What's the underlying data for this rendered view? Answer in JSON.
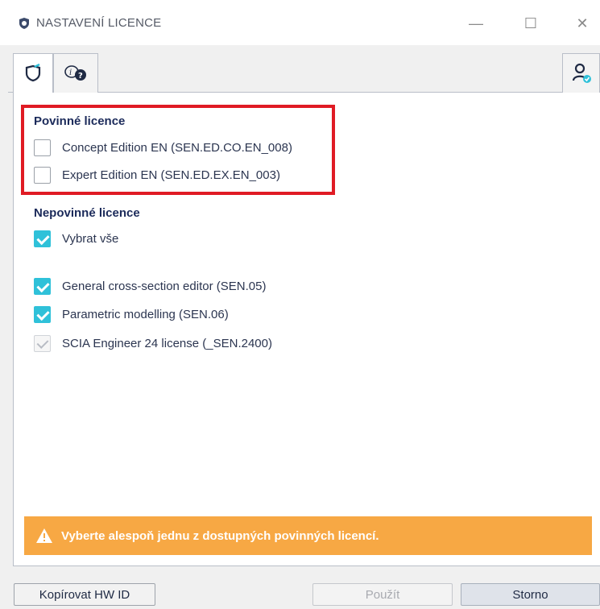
{
  "window": {
    "title": "NASTAVENÍ LICENCE",
    "minimize_glyph": "—",
    "maximize_glyph": "☐",
    "close_glyph": "✕"
  },
  "tabs": [
    {
      "icon": "shield-check-icon",
      "active": true
    },
    {
      "icon": "license-info-icon",
      "active": false
    },
    {
      "icon": "user-check-icon",
      "active": false
    }
  ],
  "mandatory": {
    "title": "Povinné licence",
    "items": [
      {
        "label": "Concept Edition EN (SEN.ED.CO.EN_008)",
        "checked": false
      },
      {
        "label": "Expert Edition EN (SEN.ED.EX.EN_003)",
        "checked": false
      }
    ]
  },
  "optional": {
    "title": "Nepovinné licence",
    "select_all": {
      "label": "Vybrat vše",
      "checked": true
    },
    "items": [
      {
        "label": "General cross-section editor (SEN.05)",
        "checked": true
      },
      {
        "label": "Parametric modelling (SEN.06)",
        "checked": true
      },
      {
        "label": "SCIA Engineer 24 license (_SEN.2400)",
        "checked": true,
        "disabled": true
      }
    ]
  },
  "warning": {
    "text": "Vyberte alespoň jednu z dostupných povinných licencí.",
    "color": "#f7a844"
  },
  "buttons": {
    "copy_hw": "Kopírovat HW ID",
    "apply": "Použít",
    "cancel": "Storno"
  },
  "colors": {
    "accent": "#2fc1d9",
    "highlight": "#e01b24"
  }
}
